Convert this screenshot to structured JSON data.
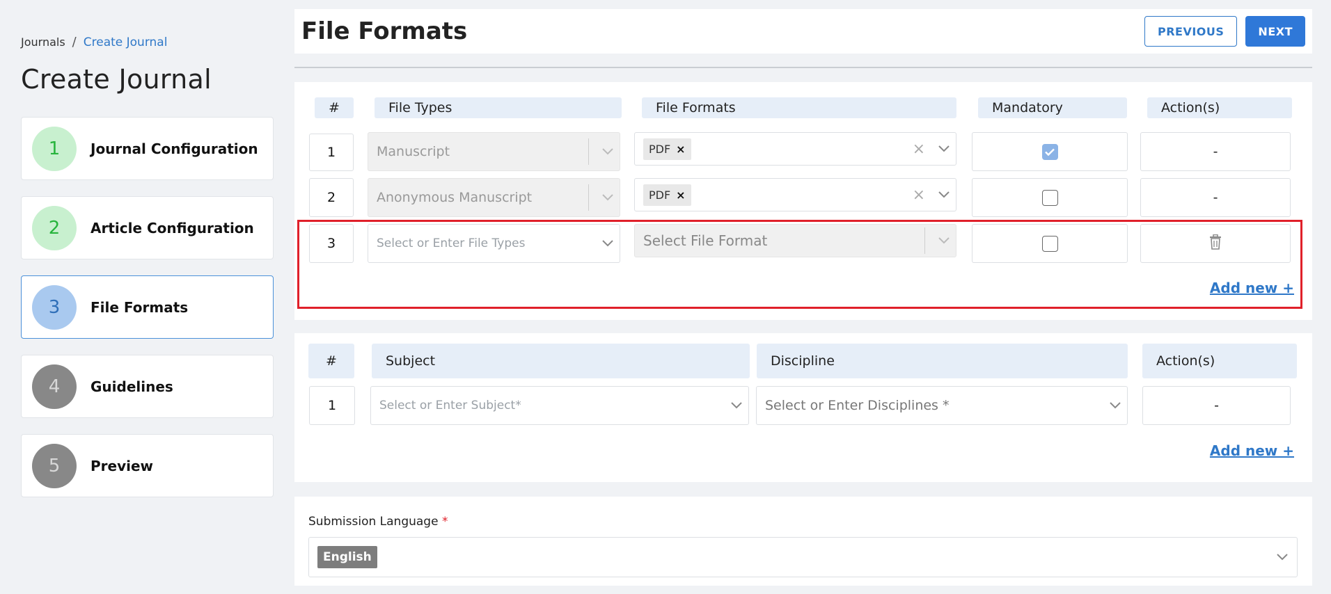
{
  "breadcrumb": {
    "root": "Journals",
    "separator": "/",
    "current": "Create Journal"
  },
  "page_title": "Create Journal",
  "steps": [
    {
      "number": "1",
      "label": "Journal Configuration",
      "state": "done"
    },
    {
      "number": "2",
      "label": "Article Configuration",
      "state": "done"
    },
    {
      "number": "3",
      "label": "File Formats",
      "state": "active"
    },
    {
      "number": "4",
      "label": "Guidelines",
      "state": "pending"
    },
    {
      "number": "5",
      "label": "Preview",
      "state": "pending"
    }
  ],
  "header": {
    "title": "File Formats",
    "previous_label": "PREVIOUS",
    "next_label": "NEXT"
  },
  "file_table": {
    "headers": {
      "num": "#",
      "file_types": "File Types",
      "file_formats": "File Formats",
      "mandatory": "Mandatory",
      "actions": "Action(s)"
    },
    "rows": [
      {
        "num": "1",
        "file_type": "Manuscript",
        "format_tag": "PDF",
        "tag_remove": "×",
        "clear": "×",
        "mandatory": true,
        "action": "-"
      },
      {
        "num": "2",
        "file_type": "Anonymous Manuscript",
        "format_tag": "PDF",
        "tag_remove": "×",
        "clear": "×",
        "mandatory": false,
        "action": "-"
      },
      {
        "num": "3",
        "file_type_placeholder": "Select or Enter File Types",
        "format_placeholder": "Select File Format",
        "mandatory": false,
        "action_icon": "trash-icon"
      }
    ],
    "add_new": "Add new +"
  },
  "subject_table": {
    "headers": {
      "num": "#",
      "subject": "Subject",
      "discipline": "Discipline",
      "actions": "Action(s)"
    },
    "rows": [
      {
        "num": "1",
        "subject_placeholder": "Select or Enter Subject*",
        "discipline_placeholder": "Select or Enter Disciplines *",
        "action": "-"
      }
    ],
    "add_new": "Add new +"
  },
  "submission_language": {
    "label": "Submission Language",
    "required_mark": "*",
    "value": "English"
  },
  "colors": {
    "accent": "#2f78c8",
    "highlight": "#e0202a",
    "done": "#27b43c"
  }
}
